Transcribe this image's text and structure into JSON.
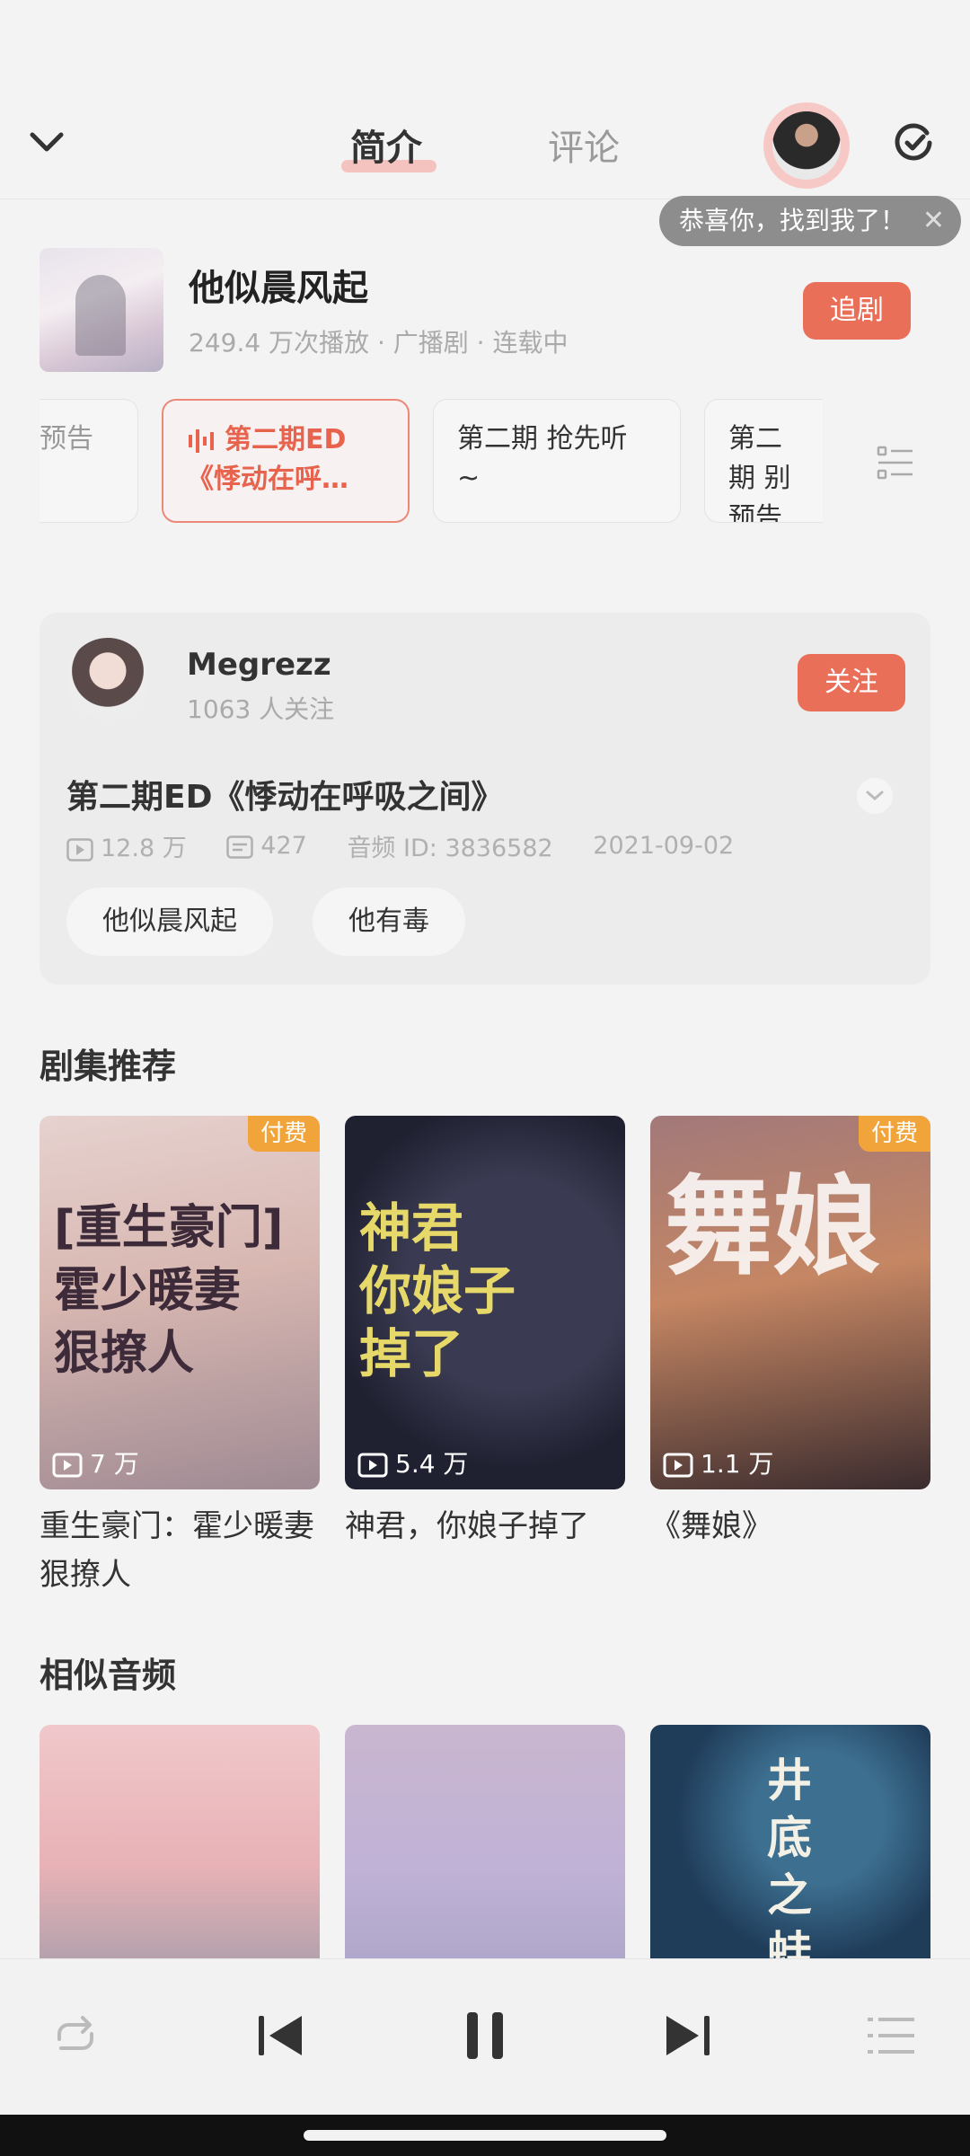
{
  "header": {
    "tabs": [
      {
        "label": "简介",
        "active": true
      },
      {
        "label": "评论",
        "active": false
      }
    ],
    "tooltip": "恭喜你，找到我了！",
    "icons": {
      "back": "chevron-down-icon",
      "refresh": "refresh-icon",
      "close": "close-icon"
    }
  },
  "drama": {
    "title": "他似晨风起",
    "meta": "249.4 万次播放 · 广播剧 · 连载中",
    "follow_label": "追剧"
  },
  "episodes": [
    {
      "label": "预告",
      "active": false
    },
    {
      "label": "第二期ED《悸动在呼…",
      "active": true
    },
    {
      "label": "第二期 抢先听 ~",
      "active": false
    },
    {
      "label": "第二期 别预告",
      "active": false
    }
  ],
  "author": {
    "name": "Megrezz",
    "followers": "1063 人关注",
    "follow_label": "关注"
  },
  "audio": {
    "title": "第二期ED《悸动在呼吸之间》",
    "plays": "12.8 万",
    "danmaku": "427",
    "audio_id": "音频 ID: 3836582",
    "date": "2021-09-02",
    "tags": [
      "他似晨风起",
      "他有毒"
    ]
  },
  "recommend": {
    "title": "剧集推荐",
    "items": [
      {
        "name": "重生豪门：霍少暖妻狠撩人",
        "plays": "7 万",
        "badge": "付费",
        "cover_text": "[重生豪门]\n霍少暖妻\n狠撩人"
      },
      {
        "name": "神君，你娘子掉了",
        "plays": "5.4 万",
        "badge": "",
        "cover_text": "神君\n你娘子\n掉了"
      },
      {
        "name": "《舞娘》",
        "plays": "1.1 万",
        "badge": "付费",
        "cover_text": "舞娘"
      }
    ]
  },
  "similar": {
    "title": "相似音频",
    "items": [
      {
        "cover_text": ""
      },
      {
        "cover_text": ""
      },
      {
        "cover_text": "井底之蛙"
      }
    ]
  },
  "player": {
    "buttons": [
      "repeat-icon",
      "previous-icon",
      "pause-icon",
      "next-icon",
      "queue-icon"
    ]
  },
  "colors": {
    "accent": "#ea6f59",
    "paid": "#f0a43a"
  }
}
